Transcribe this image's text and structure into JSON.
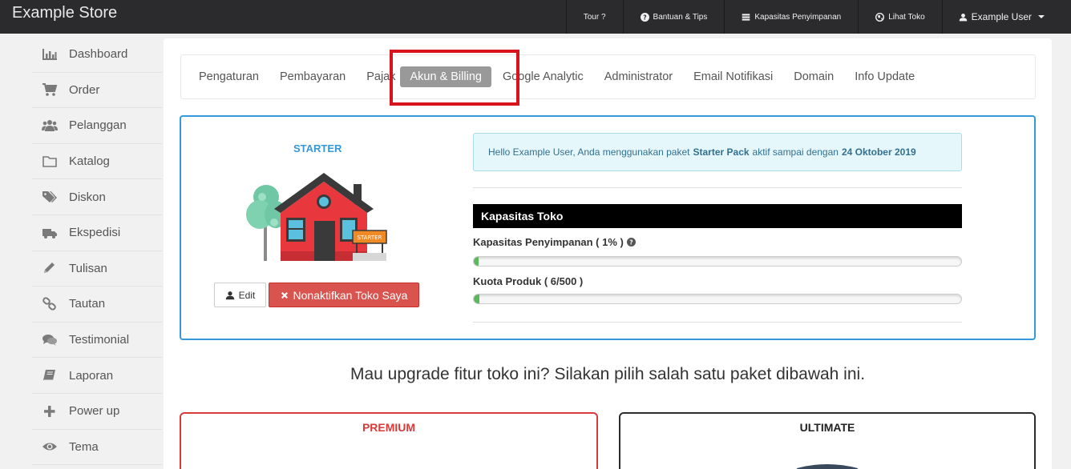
{
  "brand": "Example Store",
  "topnav": {
    "tour": "Tour ?",
    "help": "Bantuan & Tips",
    "storage": "Kapasitas Penyimpanan",
    "view_store": "Lihat Toko",
    "user": "Example User"
  },
  "sidebar": {
    "items": [
      {
        "label": "Dashboard",
        "icon": "bar-chart-icon"
      },
      {
        "label": "Order",
        "icon": "cart-icon"
      },
      {
        "label": "Pelanggan",
        "icon": "users-icon"
      },
      {
        "label": "Katalog",
        "icon": "folder-icon"
      },
      {
        "label": "Diskon",
        "icon": "tags-icon"
      },
      {
        "label": "Ekspedisi",
        "icon": "truck-icon"
      },
      {
        "label": "Tulisan",
        "icon": "pencil-icon"
      },
      {
        "label": "Tautan",
        "icon": "link-icon"
      },
      {
        "label": "Testimonial",
        "icon": "comments-icon"
      },
      {
        "label": "Laporan",
        "icon": "book-icon"
      },
      {
        "label": "Power up",
        "icon": "plus-icon"
      },
      {
        "label": "Tema",
        "icon": "eye-icon"
      }
    ]
  },
  "tabs": [
    {
      "label": "Pengaturan"
    },
    {
      "label": "Pembayaran"
    },
    {
      "label": "Pajak"
    },
    {
      "label": "Akun & Billing",
      "active": true
    },
    {
      "label": "Google Analytic"
    },
    {
      "label": "Administrator"
    },
    {
      "label": "Email Notifikasi"
    },
    {
      "label": "Domain"
    },
    {
      "label": "Info Update"
    }
  ],
  "account": {
    "plan": "STARTER",
    "sign_text": "STARTER",
    "edit_label": "Edit",
    "deactivate_label": "Nonaktifkan Toko Saya",
    "alert": {
      "prefix": "Hello Example User, Anda menggunakan paket",
      "package": "Starter Pack",
      "middle": "aktif sampai dengan",
      "date": "24 Oktober 2019"
    },
    "capacity_title": "Kapasitas Toko",
    "storage_label": "Kapasitas Penyimpanan ( 1% )",
    "storage_percent": 1,
    "product_label": "Kuota Produk ( 6/500 )",
    "product_used": 6,
    "product_max": 500
  },
  "upgrade_text": "Mau upgrade fitur toko ini? Silakan pilih salah satu paket dibawah ini.",
  "packages": {
    "premium": "PREMIUM",
    "ultimate": "ULTIMATE"
  },
  "colors": {
    "accent": "#3498db",
    "danger": "#d9534f",
    "highlight": "#d7141b",
    "progress": "#5cb85c"
  }
}
